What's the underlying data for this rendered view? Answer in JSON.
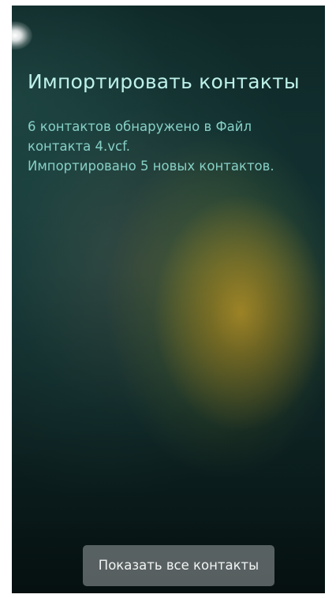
{
  "dialog": {
    "title": "Импортировать контакты",
    "message_lines": [
      "6 контактов обнаружено в Файл",
      "контакта 4.vcf.",
      "Импортировано 5 новых контактов."
    ]
  },
  "actions": {
    "show_all_label": "Показать все контакты"
  },
  "colors": {
    "title": "#bdf1e9",
    "message": "#87d0c6",
    "button_text": "#f2f4f4"
  }
}
